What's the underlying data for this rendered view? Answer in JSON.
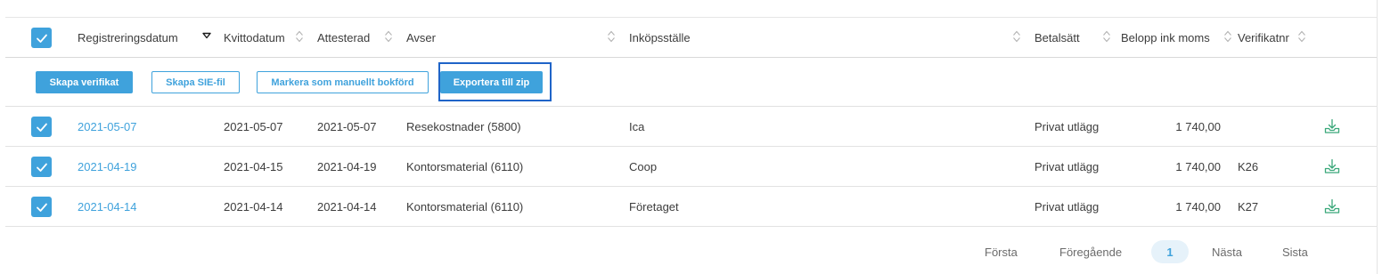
{
  "columns": {
    "registreringsdatum": "Registreringsdatum",
    "kvittodatum": "Kvittodatum",
    "attesterad": "Attesterad",
    "avser": "Avser",
    "inkopsstalle": "Inköpsställe",
    "betalsatt": "Betalsätt",
    "belopp": "Belopp ink moms",
    "verifikatnr": "Verifikatnr"
  },
  "actions": {
    "skapa_verifikat": "Skapa verifikat",
    "skapa_sie": "Skapa SIE-fil",
    "markera": "Markera som manuellt bokförd",
    "exportera": "Exportera till zip"
  },
  "rows": [
    {
      "checked": true,
      "registreringsdatum": "2021-05-07",
      "kvittodatum": "2021-05-07",
      "attesterad": "2021-05-07",
      "avser": "Resekostnader (5800)",
      "inkopsstalle": "Ica",
      "betalsatt": "Privat utlägg",
      "belopp": "1 740,00",
      "verifikatnr": "",
      "download_icon": "download-tray-icon"
    },
    {
      "checked": true,
      "registreringsdatum": "2021-04-19",
      "kvittodatum": "2021-04-15",
      "attesterad": "2021-04-19",
      "avser": "Kontorsmaterial (6110)",
      "inkopsstalle": "Coop",
      "betalsatt": "Privat utlägg",
      "belopp": "1 740,00",
      "verifikatnr": "K26",
      "download_icon": "download-tray-icon"
    },
    {
      "checked": true,
      "registreringsdatum": "2021-04-14",
      "kvittodatum": "2021-04-14",
      "attesterad": "2021-04-14",
      "avser": "Kontorsmaterial (6110)",
      "inkopsstalle": "Företaget",
      "betalsatt": "Privat utlägg",
      "belopp": "1 740,00",
      "verifikatnr": "K27",
      "download_icon": "download-tray-icon"
    }
  ],
  "pagination": {
    "first": "Första",
    "previous": "Föregående",
    "current": "1",
    "next": "Nästa",
    "last": "Sista"
  },
  "colors": {
    "accent": "#3fa2dc",
    "focus": "#1f64c8",
    "download_icon": "#3aa87a",
    "active_page_bg": "#e6f2fa"
  }
}
